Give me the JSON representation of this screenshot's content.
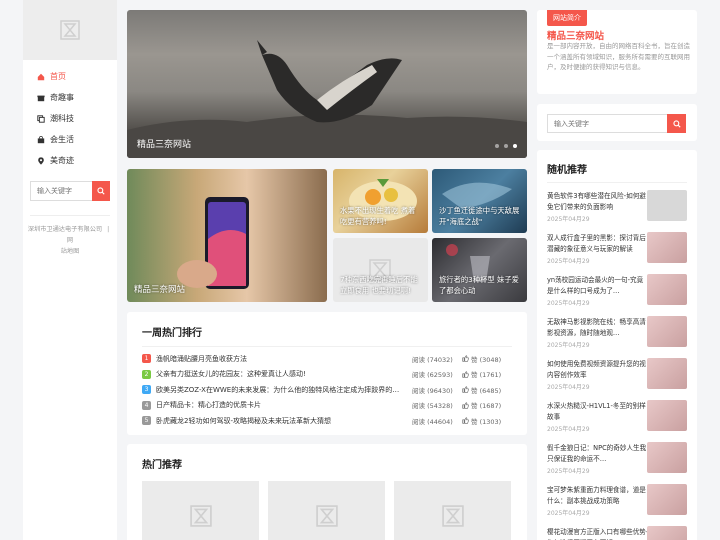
{
  "sidebar": {
    "nav": [
      {
        "label": "首页",
        "icon": "home-icon",
        "active": true
      },
      {
        "label": "奇趣事",
        "icon": "gift-icon"
      },
      {
        "label": "潮科技",
        "icon": "copy-icon"
      },
      {
        "label": "会生活",
        "icon": "bag-icon"
      },
      {
        "label": "美奇迹",
        "icon": "location-pin-icon"
      }
    ],
    "search_placeholder": "输入关键字",
    "footer_company": "深圳市卫通达电子有限公司",
    "footer_sep": "|",
    "footer_link1": "网",
    "footer_link2": "站地图"
  },
  "hero": {
    "caption": "精品三奈网站",
    "dots": 3,
    "active_dot": 3
  },
  "tiles": {
    "big": "精品三奈网站",
    "t1": "水果不出现生着吃 煮着吃更有营养吗!",
    "t2": "沙丁鱼迁徙途中与天敌展开\"海底之战\"",
    "t3": "7种东西吃完再睡后不能立即食用 也要切记啊!",
    "t4": "旅行者的3种杯型 妹子爱了都会心动"
  },
  "rank": {
    "title": "一周热门排行",
    "items": [
      {
        "num": "1",
        "color": "#f4574b",
        "text": "渔帆暗涌贴腰月亮鱼收获方法",
        "views": "阅读 (74032)",
        "likes": "赞 (3048)"
      },
      {
        "num": "2",
        "color": "#7ac943",
        "text": "父亲有力挺送女儿的花园友：这种爱真让人感动!",
        "views": "阅读 (62593)",
        "likes": "赞 (1761)"
      },
      {
        "num": "3",
        "color": "#3fa9f5",
        "text": "欧美另类ZOZ-X在WWE的未来发展：为什么他的独特风格注定成为摔跤界的下一颗璀璨明星",
        "views": "阅读 (96430)",
        "likes": "赞 (6485)"
      },
      {
        "num": "4",
        "color": "#999999",
        "text": "日产精品卡：精心打造的优质卡片",
        "views": "阅读 (54328)",
        "likes": "赞 (1687)"
      },
      {
        "num": "5",
        "color": "#999999",
        "text": "卧虎藏龙2轻功如何驾驭-攻略揭秘及未来玩法革新大猜想",
        "views": "阅读 (44604)",
        "likes": "赞 (1303)"
      }
    ]
  },
  "hot": {
    "title": "热门推荐",
    "count": 3
  },
  "about": {
    "tag": "网站简介",
    "title": "精品三奈网站",
    "desc": "是一部内容开放，自由的网络百科全书，旨在创造一个涵盖所有领域知识，服务所有需要的互联网用户，及时便捷的获得知识与信息。"
  },
  "right_search": {
    "placeholder": "输入关键字"
  },
  "random": {
    "title": "随机推荐",
    "items": [
      {
        "title": "黄色软件3有哪些潜在风险-如何避免它们带来的负面影响",
        "date": "2025年04月29",
        "thumb": "gray"
      },
      {
        "title": "双人成行盒子里的黑影：探讨背后潜藏的象征意义与玩家的解读",
        "date": "2025年04月29",
        "thumb": "pink"
      },
      {
        "title": "yn荡校园运动会最火的一句-究竟是什么样的口号成为了…",
        "date": "2025年04月29",
        "thumb": "pink"
      },
      {
        "title": "无敌神马影视影院在线：畅享高清影视资源，随时随地观…",
        "date": "2025年04月29",
        "thumb": "pink"
      },
      {
        "title": "如何使用免费视频资源提升您的视内容创作效率",
        "date": "2025年04月29",
        "thumb": "pink"
      },
      {
        "title": "水深火热糙汉-H1VL1-冬至的别样故事",
        "date": "2025年04月29",
        "thumb": "pink"
      },
      {
        "title": "假千金狼日记：NPC的奇妙人生我只保证我的命运不…",
        "date": "2025年04月29",
        "thumb": "pink"
      },
      {
        "title": "宝可梦朱紫重面力料理食谱，道是什么：副本挑战成功策略",
        "date": "2025年04月29",
        "thumb": "pink"
      },
      {
        "title": "樱花动漫官方正版入口有哪些优势-为何选择正版平台更好",
        "date": "2025年04月29",
        "thumb": "pink"
      }
    ]
  }
}
